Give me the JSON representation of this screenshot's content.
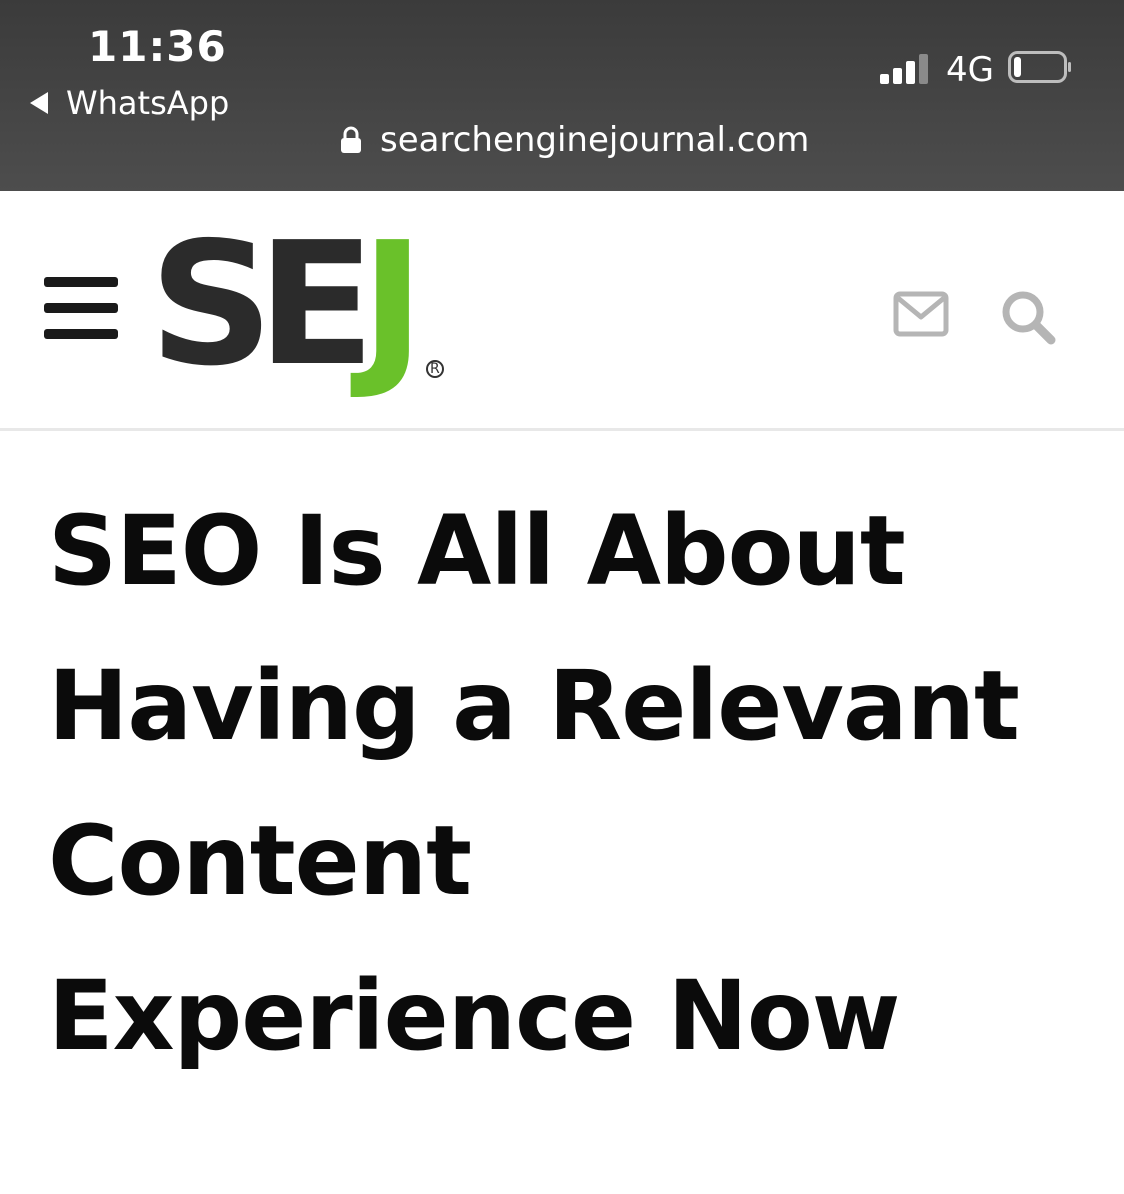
{
  "status_bar": {
    "time": "11:36",
    "back_app": "WhatsApp",
    "network": "4G",
    "battery_level": 0.15
  },
  "url_bar": {
    "domain": "searchenginejournal.com"
  },
  "header": {
    "logo": {
      "letters": [
        "S",
        "E",
        "J"
      ],
      "registered": "®",
      "colors": {
        "dark": "#2b2b2b",
        "accent": "#6ac12a"
      }
    },
    "icons": [
      "menu-icon",
      "mail-icon",
      "search-icon"
    ]
  },
  "article": {
    "title_lines": [
      "SEO Is All About",
      "Having a Relevant",
      "Content",
      "Experience Now"
    ]
  }
}
